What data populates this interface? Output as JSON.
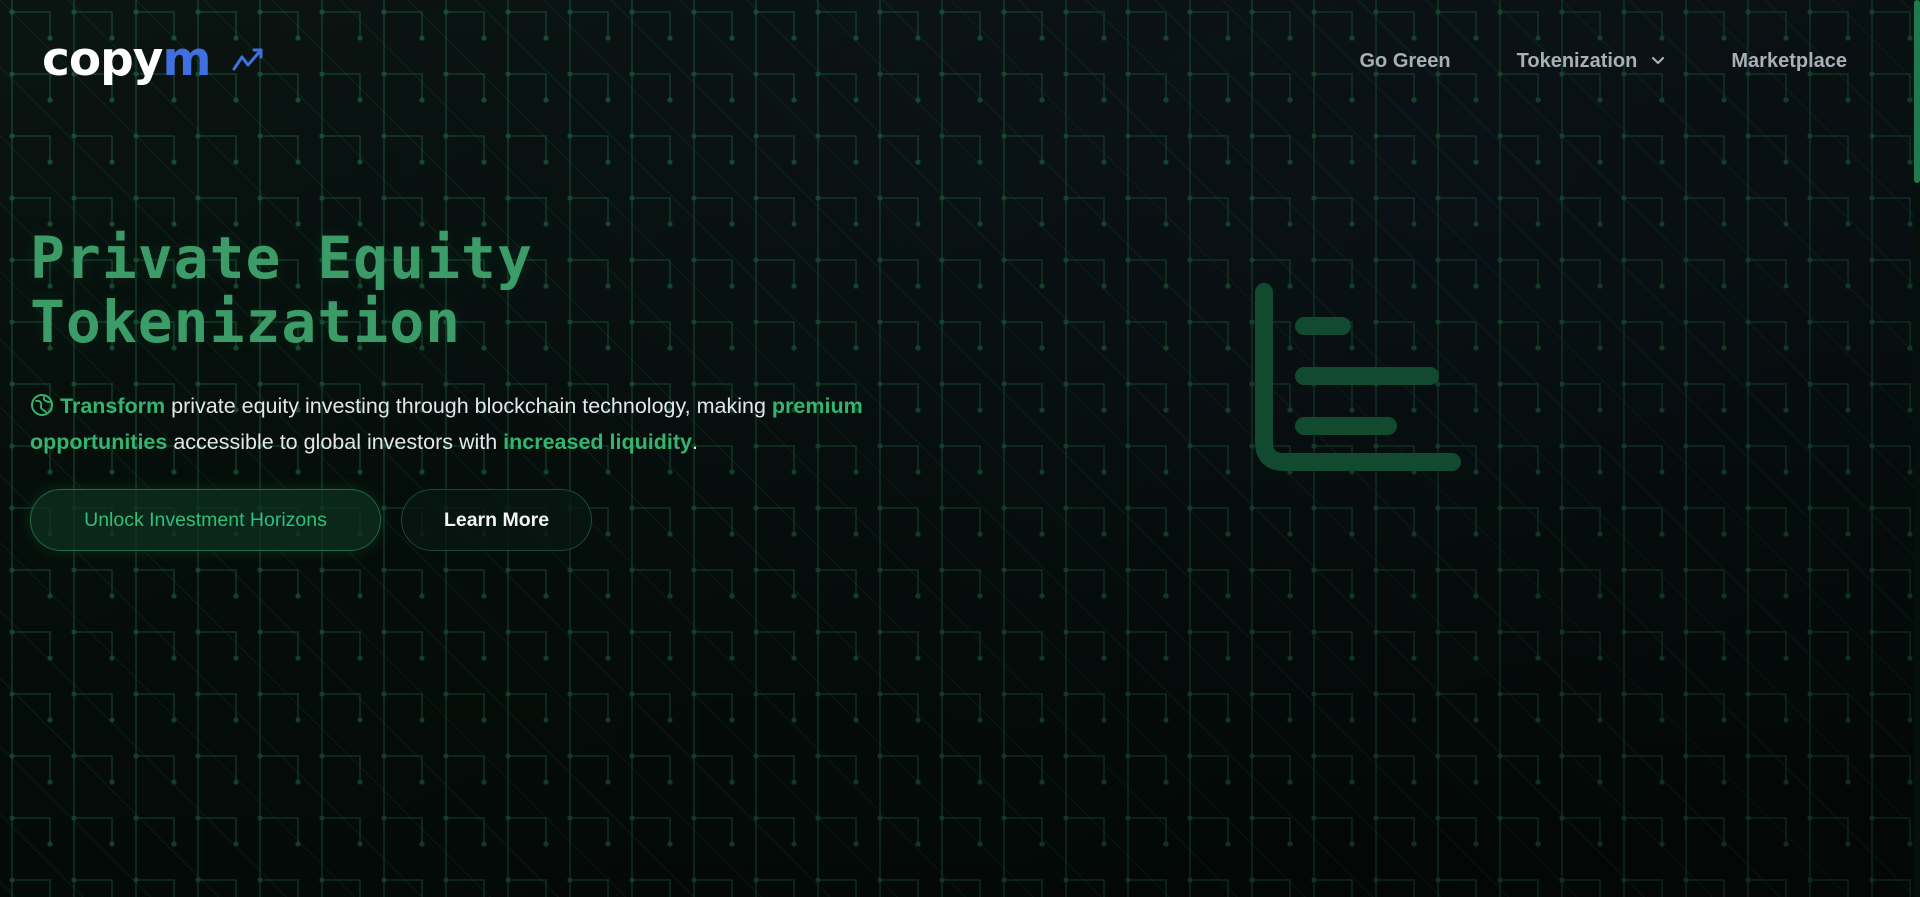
{
  "header": {
    "logo": {
      "text_main": "copy",
      "text_accent": "m"
    },
    "nav": [
      {
        "label": "Go Green",
        "has_dropdown": false
      },
      {
        "label": "Tokenization",
        "has_dropdown": true
      },
      {
        "label": "Marketplace",
        "has_dropdown": false
      }
    ]
  },
  "hero": {
    "title_line1": "Private Equity",
    "title_line2": "Tokenization",
    "description": {
      "highlight1": "Transform",
      "text1": " private equity investing through blockchain technology, making ",
      "highlight2": "premium opportunities",
      "text2": " accessible to global investors with ",
      "highlight3": "increased liquidity",
      "text3": "."
    },
    "primary_cta": "Unlock Investment Horizons",
    "secondary_cta": "Learn More"
  },
  "icons": {
    "logo_mark": "trend-line-icon",
    "nav_dropdown": "chevron-down-icon",
    "description_leading": "leaf-globe-icon",
    "hero_graphic": "chart-bars-icon"
  },
  "colors": {
    "background": "#07100d",
    "accent_green": "#33b56e",
    "title_green": "#3c9c68",
    "logo_blue": "#3f6fe0",
    "nav_text": "#a8afb8"
  }
}
